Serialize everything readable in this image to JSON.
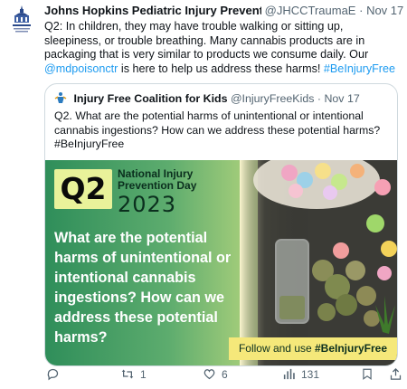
{
  "tweet": {
    "author_name": "Johns Hopkins Pediatric Injury Prevention Pr",
    "author_handle": "@JHCCTraumaE",
    "dot": "·",
    "time": "Nov 17",
    "text_lead": "Q2: In children, they may have trouble walking or sitting up, sleepiness, or trouble breathing. Many cannabis products are in packaging that is very similar to products we consume daily. Our ",
    "mention": "@mdpoisonctr",
    "text_mid": " is here to help us address these harms! ",
    "hashtag": "#BeInjuryFree"
  },
  "quote": {
    "author_name": "Injury Free Coalition for Kids",
    "author_handle": "@InjuryFreeKids",
    "dot": "·",
    "time": "Nov 17",
    "text": "Q2. What are the potential harms of unintentional or intentional cannabis ingestions? How can we address these potential harms? #BeInjuryFree",
    "graphic": {
      "badge": "Q2",
      "event_title": "National Injury Prevention Day",
      "year": "2023",
      "question": "What are the potential harms of unintentional or intentional cannabis ingestions? How can we address these potential harms?",
      "follow_prefix": "Follow and use ",
      "follow_hashtag": "#BeInjuryFree"
    }
  },
  "actions": {
    "reply_icon": "reply-icon",
    "retweet_icon": "retweet-icon",
    "retweet_count": "1",
    "like_icon": "heart-icon",
    "like_count": "6",
    "views_icon": "views-icon",
    "views_count": "131",
    "bookmark_icon": "bookmark-icon",
    "share_icon": "share-icon"
  },
  "colors": {
    "link": "#1d9bf0",
    "muted": "#536471",
    "text": "#0f1419",
    "border": "#cfd9de",
    "banner_green": "#2f8e5a",
    "badge_yellow": "#e9f29a",
    "follow_bar": "#f5e87a"
  }
}
